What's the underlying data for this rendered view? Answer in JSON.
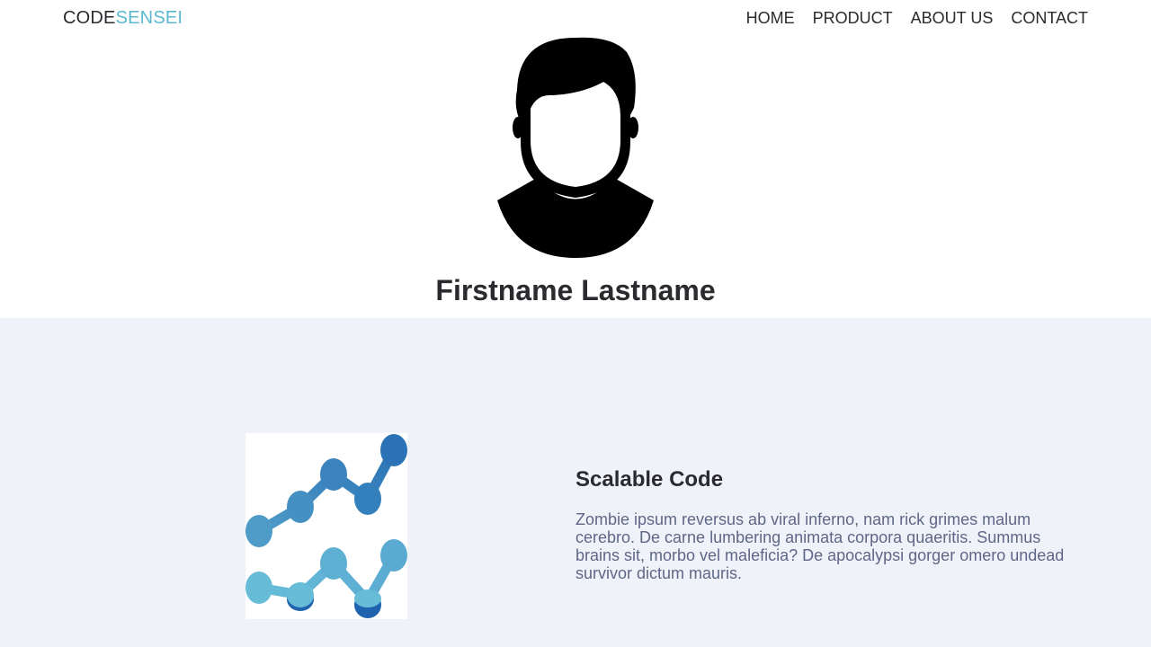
{
  "nav": {
    "brand_part1": "CODE",
    "brand_part2": "SENSEI",
    "links": [
      "HOME",
      "PRODUCT",
      "ABOUT US",
      "CONTACT"
    ]
  },
  "profile": {
    "name": "Firstname Lastname",
    "avatar_icon": "user-silhouette-icon"
  },
  "feature": {
    "title": "Scalable Code",
    "text": "Zombie ipsum reversus ab viral inferno, nam rick grimes malum cerebro. De carne lumbering animata corpora quaeritis. Summus brains sit, morbo vel maleficia? De apocalypsi gorger omero undead survivor dictum mauris.",
    "image_icon": "line-chart-icon"
  },
  "colors": {
    "brand_accent": "#5bb8cf",
    "feature_background": "#eff2f9",
    "body_text": "#5f6787"
  }
}
